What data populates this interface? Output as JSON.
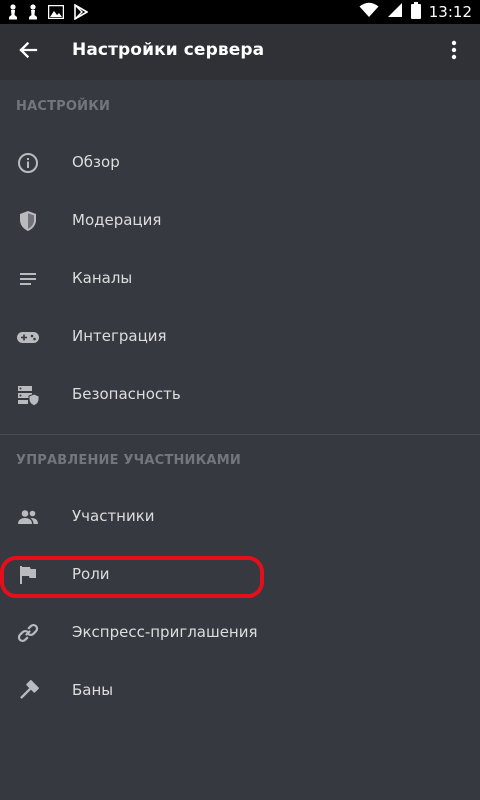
{
  "status_bar": {
    "time": "13:12"
  },
  "app_bar": {
    "title": "Настройки сервера"
  },
  "sections": [
    {
      "header": "НАСТРОЙКИ",
      "items": [
        {
          "label": "Обзор",
          "icon": "info-icon"
        },
        {
          "label": "Модерация",
          "icon": "shield-icon"
        },
        {
          "label": "Каналы",
          "icon": "channels-list-icon"
        },
        {
          "label": "Интеграция",
          "icon": "gamepad-icon"
        },
        {
          "label": "Безопасность",
          "icon": "server-shield-icon"
        }
      ]
    },
    {
      "header": "УПРАВЛЕНИЕ УЧАСТНИКАМИ",
      "items": [
        {
          "label": "Участники",
          "icon": "members-icon"
        },
        {
          "label": "Роли",
          "icon": "flag-icon"
        },
        {
          "label": "Экспресс-приглашения",
          "icon": "link-icon"
        },
        {
          "label": "Баны",
          "icon": "hammer-icon"
        }
      ]
    }
  ],
  "colors": {
    "background": "#36393f",
    "app_bar": "#2f3136",
    "text": "#dcddde",
    "header_text": "#72767d",
    "highlight": "#e3101b"
  }
}
